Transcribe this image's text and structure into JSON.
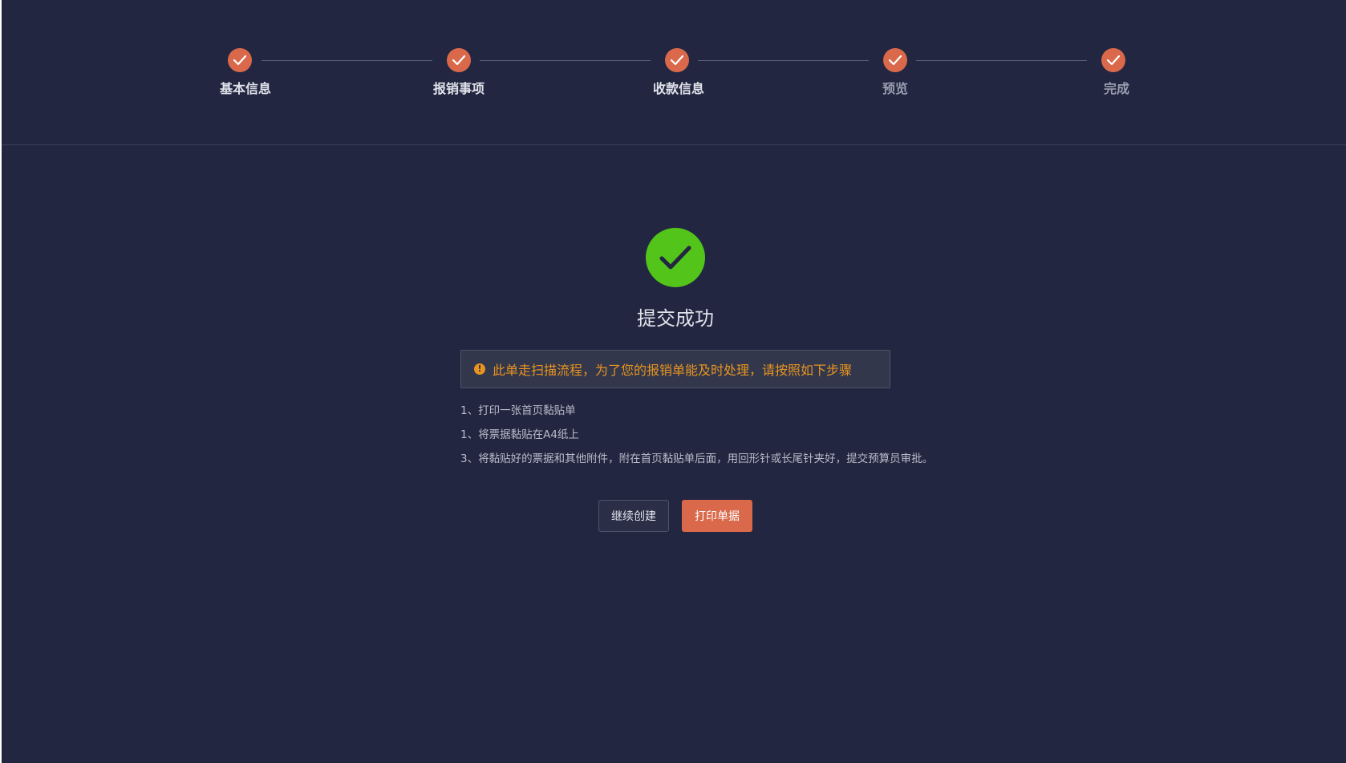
{
  "colors": {
    "background": "#222640",
    "accent": "#d9694a",
    "success": "#52c41a",
    "warning": "#e8941f",
    "text_primary": "#e0e2ea",
    "text_secondary": "#9a9eb0",
    "text_muted": "#b8bbc8"
  },
  "steps": {
    "items": [
      {
        "label": "基本信息",
        "status": "done",
        "icon": "check-icon"
      },
      {
        "label": "报销事项",
        "status": "done",
        "icon": "check-icon"
      },
      {
        "label": "收款信息",
        "status": "done",
        "icon": "check-icon"
      },
      {
        "label": "预览",
        "status": "done",
        "icon": "check-icon"
      },
      {
        "label": "完成",
        "status": "done",
        "icon": "check-icon"
      }
    ]
  },
  "result": {
    "icon": "success-check-icon",
    "title": "提交成功",
    "alert": {
      "icon": "exclamation-icon",
      "text": "此单走扫描流程，为了您的报销单能及时处理，请按照如下步骤"
    },
    "instructions": [
      "1、打印一张首页黏贴单",
      "1、将票据黏贴在A4纸上",
      "3、将黏贴好的票据和其他附件，附在首页黏贴单后面，用回形针或长尾针夹好，提交预算员审批。"
    ]
  },
  "actions": {
    "continue_label": "继续创建",
    "print_label": "打印单据"
  }
}
